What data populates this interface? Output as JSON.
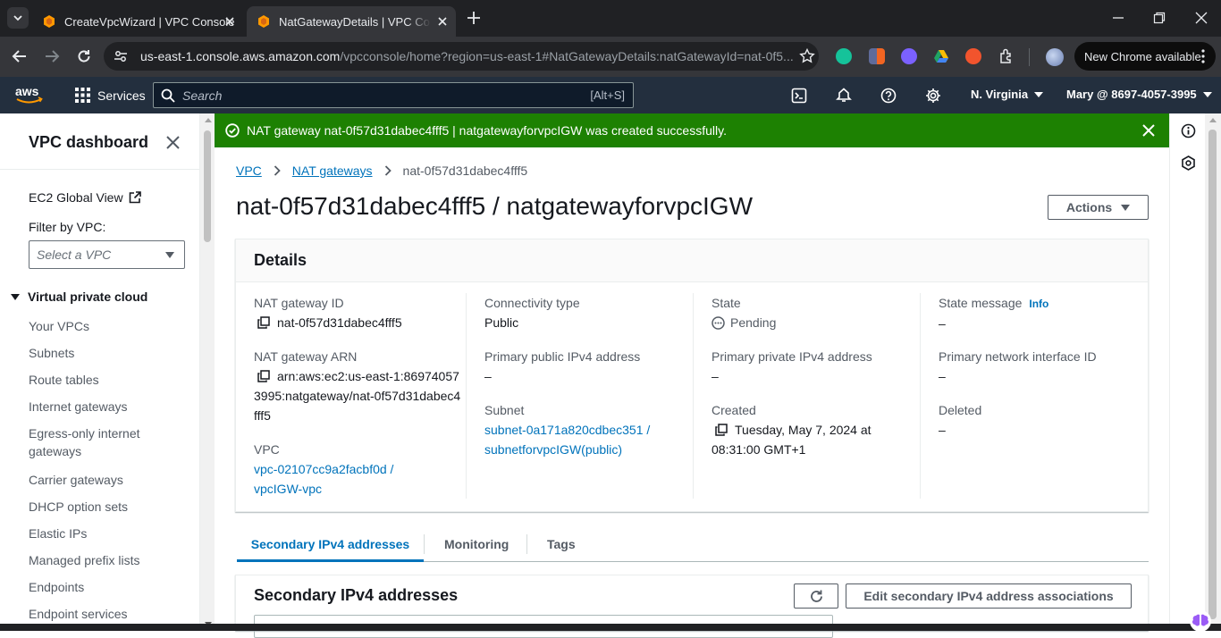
{
  "browser": {
    "tabs": [
      {
        "title": "CreateVpcWizard | VPC Console",
        "active": false
      },
      {
        "title": "NatGatewayDetails | VPC Console",
        "active": true
      }
    ],
    "url_host": "us-east-1.console.aws.amazon.com",
    "url_path": "/vpcconsole/home?region=us-east-1#NatGatewayDetails:natGatewayId=nat-0f5...",
    "update_label": "New Chrome available"
  },
  "aws_nav": {
    "services_label": "Services",
    "search_placeholder": "Search",
    "search_shortcut": "[Alt+S]",
    "region": "N. Virginia",
    "account": "Mary @ 8697-4057-3995"
  },
  "sidebar": {
    "title": "VPC dashboard",
    "ec2_global_view": "EC2 Global View",
    "filter_label": "Filter by VPC:",
    "filter_placeholder": "Select a VPC",
    "section": "Virtual private cloud",
    "items": [
      {
        "label": "Your VPCs"
      },
      {
        "label": "Subnets"
      },
      {
        "label": "Route tables"
      },
      {
        "label": "Internet gateways"
      },
      {
        "label": "Egress-only internet gateways"
      },
      {
        "label": "Carrier gateways"
      },
      {
        "label": "DHCP option sets"
      },
      {
        "label": "Elastic IPs"
      },
      {
        "label": "Managed prefix lists"
      },
      {
        "label": "Endpoints"
      },
      {
        "label": "Endpoint services"
      }
    ]
  },
  "flash": {
    "message": "NAT gateway nat-0f57d31dabec4fff5 | natgatewayforvpcIGW was created successfully.",
    "color": "#1d8102"
  },
  "breadcrumb": {
    "items": [
      "VPC",
      "NAT gateways"
    ],
    "current": "nat-0f57d31dabec4fff5"
  },
  "page": {
    "title": "nat-0f57d31dabec4fff5 / natgatewayforvpcIGW",
    "actions_label": "Actions"
  },
  "details": {
    "heading": "Details",
    "nat_gateway_id_label": "NAT gateway ID",
    "nat_gateway_id": "nat-0f57d31dabec4fff5",
    "arn_label": "NAT gateway ARN",
    "arn": "arn:aws:ec2:us-east-1:869740573995:natgateway/nat-0f57d31dabec4fff5",
    "vpc_label": "VPC",
    "vpc": "vpc-02107cc9a2facbf0d / vpcIGW-vpc",
    "connectivity_label": "Connectivity type",
    "connectivity": "Public",
    "public_ip_label": "Primary public IPv4 address",
    "public_ip": "–",
    "subnet_label": "Subnet",
    "subnet": "subnet-0a171a820cdbec351 / subnetforvpcIGW(public)",
    "state_label": "State",
    "state": "Pending",
    "private_ip_label": "Primary private IPv4 address",
    "private_ip": "–",
    "created_label": "Created",
    "created": "Tuesday, May 7, 2024 at 08:31:00 GMT+1",
    "state_message_label": "State message",
    "info_label": "Info",
    "state_message": "–",
    "eni_label": "Primary network interface ID",
    "eni": "–",
    "deleted_label": "Deleted",
    "deleted": "–"
  },
  "tabs": [
    "Secondary IPv4 addresses",
    "Monitoring",
    "Tags"
  ],
  "secondary": {
    "heading": "Secondary IPv4 addresses",
    "edit_label": "Edit secondary IPv4 address associations"
  }
}
